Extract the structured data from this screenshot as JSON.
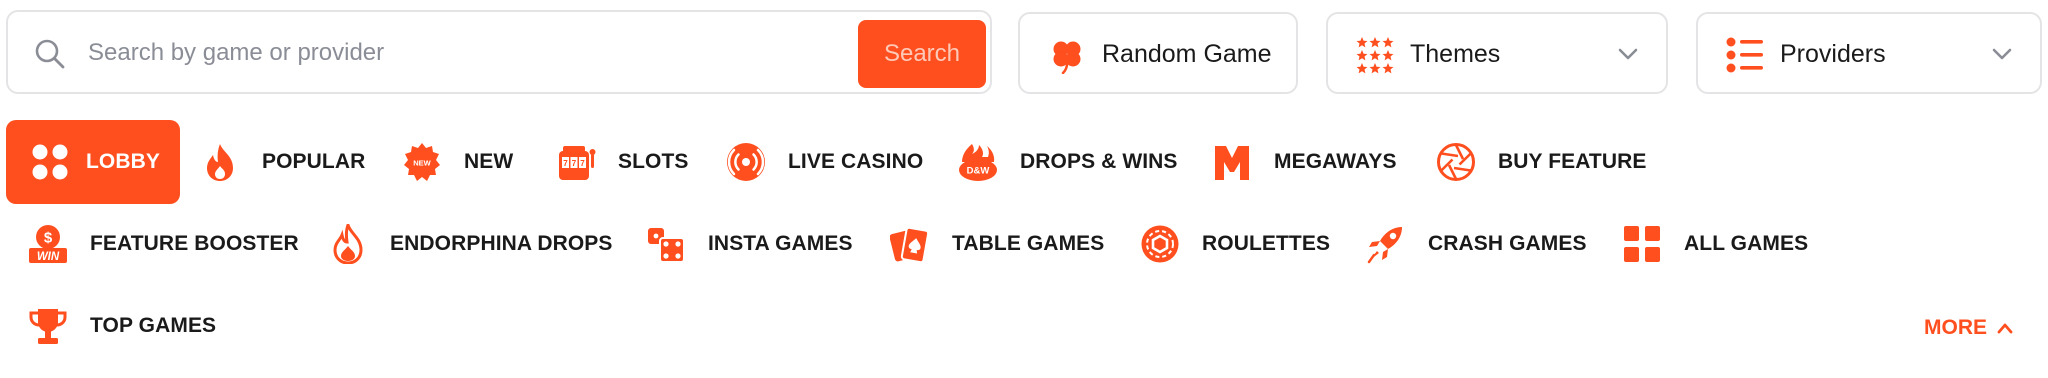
{
  "search": {
    "placeholder": "Search by game or provider",
    "button_label": "Search",
    "icon": "search-icon"
  },
  "filters": {
    "random_game": {
      "label": "Random Game",
      "icon": "clover-icon"
    },
    "themes": {
      "label": "Themes",
      "icon": "stars-grid-icon"
    },
    "providers": {
      "label": "Providers",
      "icon": "list-icon"
    }
  },
  "nav": {
    "items": [
      {
        "label": "LOBBY",
        "icon": "dots-grid-icon",
        "active": true
      },
      {
        "label": "POPULAR",
        "icon": "flame-icon"
      },
      {
        "label": "NEW",
        "icon": "new-badge-icon"
      },
      {
        "label": "SLOTS",
        "icon": "slot-machine-icon"
      },
      {
        "label": "LIVE CASINO",
        "icon": "live-broadcast-icon"
      },
      {
        "label": "DROPS & WINS",
        "icon": "drops-wins-icon"
      },
      {
        "label": "MEGAWAYS",
        "icon": "megaways-icon"
      },
      {
        "label": "BUY FEATURE",
        "icon": "aperture-icon"
      },
      {
        "label": "FEATURE BOOSTER",
        "icon": "dollar-win-icon"
      },
      {
        "label": "ENDORPHINA DROPS",
        "icon": "fire-drop-icon"
      },
      {
        "label": "INSTA GAMES",
        "icon": "dice-icon"
      },
      {
        "label": "TABLE GAMES",
        "icon": "playing-cards-icon"
      },
      {
        "label": "ROULETTES",
        "icon": "roulette-icon"
      },
      {
        "label": "CRASH GAMES",
        "icon": "rocket-icon"
      },
      {
        "label": "ALL GAMES",
        "icon": "four-squares-icon"
      },
      {
        "label": "TOP GAMES",
        "icon": "trophy-icon"
      }
    ],
    "more_label": "MORE"
  },
  "colors": {
    "accent": "#ff4f1f",
    "border": "#e4e4e6",
    "text": "#1a1a1a",
    "placeholder": "#8a8d96"
  }
}
